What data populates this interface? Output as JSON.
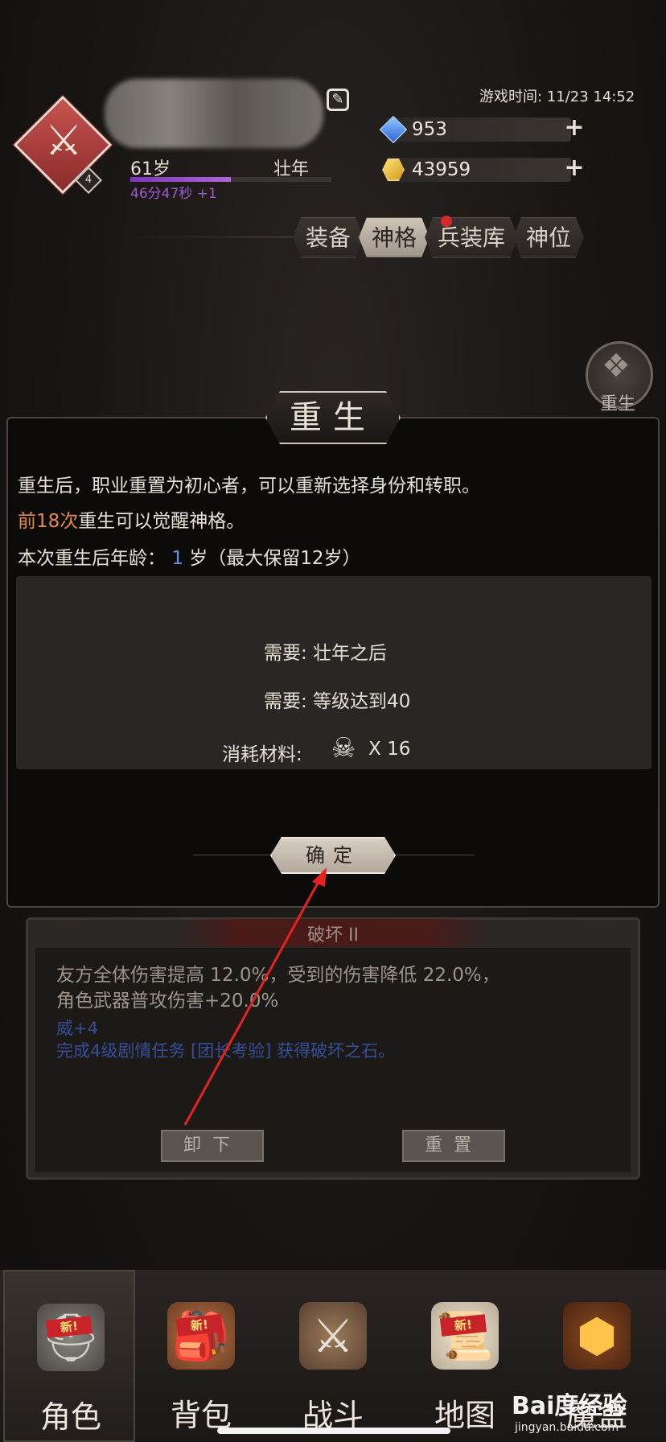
{
  "header": {
    "age": "61岁",
    "life_stage": "壮年",
    "timer": "46分47秒 +1",
    "age_progress": 0.5,
    "rank": "4",
    "game_time": "游戏时间: 11/23 14:52",
    "gems": "953",
    "gold": "43959"
  },
  "tabs": [
    {
      "label": "装备"
    },
    {
      "label": "神格"
    },
    {
      "label": "兵装库"
    },
    {
      "label": "神位"
    }
  ],
  "side_button": {
    "label": "重生"
  },
  "dialog": {
    "title": "重生",
    "desc1": "重生后，职业重置为初心者，可以重新选择身份和转职。",
    "desc2_highlight": "前18次",
    "desc2_rest": "重生可以觉醒神格。",
    "desc3_prefix": "本次重生后年龄：",
    "desc3_value": "1",
    "desc3_suffix": "岁（最大保留12岁）",
    "req1": "需要: 壮年之后",
    "req2": "需要: 等级达到40",
    "req3_label": "消耗材料:",
    "req3_count": "X 16",
    "confirm": "确定"
  },
  "lower_panel": {
    "title": "破坏 II",
    "line1": "友方全体伤害提高 12.0%，受到的伤害降低 22.0%，",
    "line2": "角色武器普攻伤害+20.0%",
    "line3": "威+4",
    "line4": "完成4级剧情任务 [团长考验] 获得破坏之石。",
    "unload": "卸下",
    "reset": "重置"
  },
  "nav": [
    {
      "label": "角色",
      "icon": "helmet-icon",
      "new_badge": "新!"
    },
    {
      "label": "背包",
      "icon": "backpack-icon",
      "new_badge": "新!"
    },
    {
      "label": "战斗",
      "icon": "sword-shield-icon",
      "new_badge": ""
    },
    {
      "label": "地图",
      "icon": "scroll-icon",
      "new_badge": "新!"
    },
    {
      "label": "魔盒",
      "icon": "magic-box-icon",
      "new_badge": ""
    }
  ],
  "watermark": {
    "text": "Bai度经验",
    "url": "jingyan.baidu.com"
  },
  "colors": {
    "accent_orange": "#e08a4d",
    "accent_blue": "#5a96e6",
    "tab_dot": "#d32a2a"
  }
}
